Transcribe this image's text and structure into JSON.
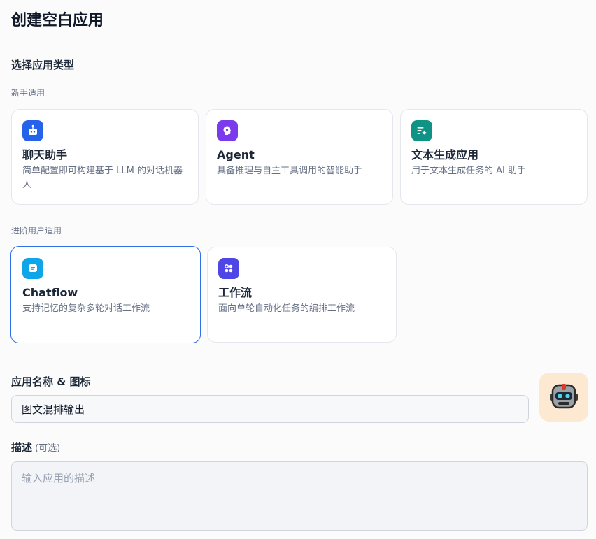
{
  "page": {
    "title": "创建空白应用"
  },
  "app_type": {
    "section_title": "选择应用类型",
    "beginner": {
      "label": "新手适用",
      "cards": [
        {
          "title": "聊天助手",
          "desc": "简单配置即可构建基于 LLM 的对话机器人",
          "icon": "chat-robot-icon",
          "color": "#2563eb"
        },
        {
          "title": "Agent",
          "desc": "具备推理与自主工具调用的智能助手",
          "icon": "agent-brain-icon",
          "color": "#7c3aed"
        },
        {
          "title": "文本生成应用",
          "desc": "用于文本生成任务的 AI 助手",
          "icon": "text-sparkle-icon",
          "color": "#0e9384"
        }
      ]
    },
    "advanced": {
      "label": "进阶用户适用",
      "cards": [
        {
          "title": "Chatflow",
          "desc": "支持记忆的复杂多轮对话工作流",
          "icon": "chatflow-bubble-icon",
          "color": "#0ea5e9",
          "selected": true
        },
        {
          "title": "工作流",
          "desc": "面向单轮自动化任务的编排工作流",
          "icon": "workflow-nodes-icon",
          "color": "#4f46e5"
        }
      ]
    }
  },
  "name_field": {
    "label": "应用名称 & 图标",
    "value": "图文混排输出",
    "avatar_icon": "robot-avatar-icon",
    "avatar_bg": "#fde8d2"
  },
  "desc_field": {
    "label": "描述",
    "optional": "(可选)",
    "placeholder": "输入应用的描述"
  }
}
